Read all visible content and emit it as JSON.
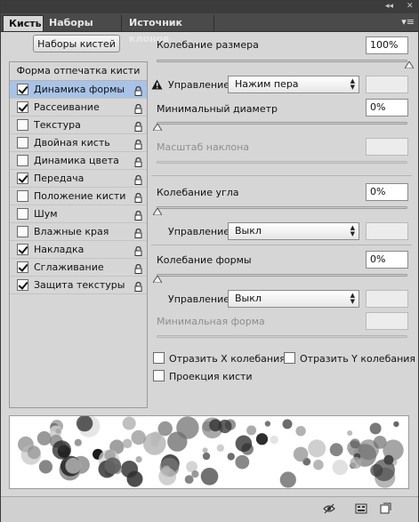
{
  "titlebar": {
    "collapse_glyph": "◂◂",
    "close_glyph": "✕"
  },
  "tabs": [
    {
      "label": "Кисть",
      "active": true
    },
    {
      "label": "Наборы кистей",
      "active": false
    },
    {
      "label": "Источник клонов",
      "active": false
    }
  ],
  "menu_icon": "▾≡",
  "presets_button": "Наборы кистей",
  "left_header": "Форма отпечатка кисти",
  "left_items": [
    {
      "label": "Динамика формы",
      "checked": true,
      "selected": true
    },
    {
      "label": "Рассеивание",
      "checked": true
    },
    {
      "label": "Текстура",
      "checked": false
    },
    {
      "label": "Двойная кисть",
      "checked": false
    },
    {
      "label": "Динамика цвета",
      "checked": false
    },
    {
      "label": "Передача",
      "checked": true
    },
    {
      "label": "Положение кисти",
      "checked": false
    },
    {
      "label": "Шум",
      "checked": false
    },
    {
      "label": "Влажные края",
      "checked": false
    },
    {
      "label": "Накладка",
      "checked": true
    },
    {
      "label": "Сглаживание",
      "checked": true
    },
    {
      "label": "Защита текстуры",
      "checked": true
    }
  ],
  "size_jitter": {
    "label": "Колебание размера",
    "value": "100%",
    "level": 1.0
  },
  "size_control": {
    "warning_icon": "⚠",
    "label": "Управление:",
    "value": "Нажим пера"
  },
  "min_diameter": {
    "label": "Минимальный диаметр",
    "value": "0%",
    "level": 0.0
  },
  "tilt_scale": {
    "label": "Масштаб наклона",
    "value": ""
  },
  "angle_jitter": {
    "label": "Колебание угла",
    "value": "0%",
    "level": 0.0
  },
  "angle_control": {
    "label": "Управление:",
    "value": "Выкл"
  },
  "roundness_jitter": {
    "label": "Колебание формы",
    "value": "0%",
    "level": 0.0
  },
  "roundness_control": {
    "label": "Управление:",
    "value": "Выкл"
  },
  "min_roundness": {
    "label": "Минимальная форма",
    "value": ""
  },
  "flip_x": {
    "label": "Отразить X колебания",
    "checked": false
  },
  "flip_y": {
    "label": "Отразить Y колебания",
    "checked": false
  },
  "brush_projection": {
    "label": "Проекция кисти",
    "checked": false
  },
  "select_arrows": "▲▼",
  "footer_icons": [
    "eye-icon",
    "grid-panel-icon",
    "new-preset-icon"
  ]
}
